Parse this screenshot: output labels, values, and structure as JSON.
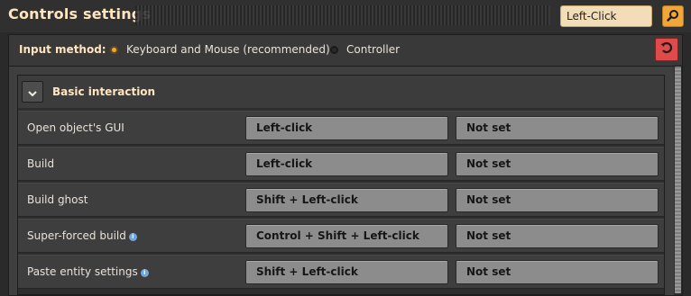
{
  "window": {
    "title": "Controls settings"
  },
  "search": {
    "value": "Left-Click"
  },
  "input_method": {
    "label": "Input method:",
    "options": [
      {
        "label": "Keyboard and Mouse (recommended)",
        "selected": true
      },
      {
        "label": "Controller",
        "selected": false
      }
    ]
  },
  "section": {
    "title": "Basic interaction",
    "rows": [
      {
        "label": "Open object's GUI",
        "info": false,
        "primary": "Left-click",
        "secondary": "Not set"
      },
      {
        "label": "Build",
        "info": false,
        "primary": "Left-click",
        "secondary": "Not set"
      },
      {
        "label": "Build ghost",
        "info": false,
        "primary": "Shift + Left-click",
        "secondary": "Not set"
      },
      {
        "label": "Super-forced build",
        "info": true,
        "primary": "Control + Shift + Left-click",
        "secondary": "Not set"
      },
      {
        "label": "Paste entity settings",
        "info": true,
        "primary": "Shift + Left-click",
        "secondary": "Not set"
      }
    ]
  },
  "colors": {
    "accent": "#f0a63a",
    "reset": "#e04a4a",
    "title": "#ffe6c0"
  }
}
